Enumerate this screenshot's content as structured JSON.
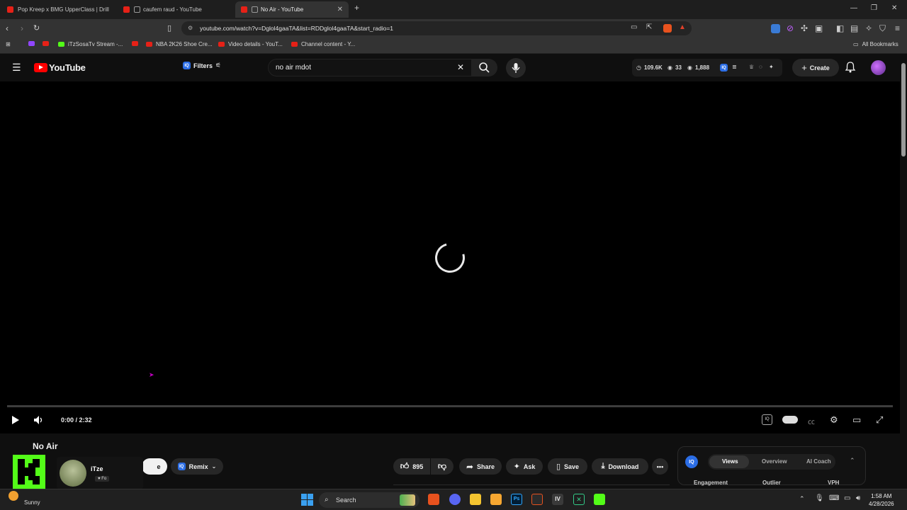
{
  "browser": {
    "tabs": [
      {
        "label": "Pop Kreep x BMG UpperClass | Drill"
      },
      {
        "label": "caufem raud - YouTube"
      },
      {
        "label": "No Air - YouTube",
        "active": true
      }
    ],
    "url": "youtube.com/watch?v=Dglol4gaaTA&list=RDDglol4gaaTA&start_radio=1",
    "bookmarks": [
      {
        "label": "iTzSosaTv Stream -..."
      },
      {
        "label": "NBA 2K26 Shoe Cre..."
      },
      {
        "label": "Video details - YouT..."
      },
      {
        "label": "Channel content - Y..."
      }
    ],
    "all_bookmarks": "All Bookmarks"
  },
  "youtube": {
    "logo_text": "YouTube",
    "filters_label": "Filters",
    "search_value": "no air mdot",
    "stats": {
      "views": "109.6K",
      "count_a": "33",
      "count_b": "1,888"
    },
    "create_label": "Create"
  },
  "player": {
    "time": "0:00 / 2:32",
    "progress": 0
  },
  "video": {
    "title": "No Air",
    "remix_label": "Remix",
    "likes": "895",
    "share_label": "Share",
    "ask_label": "Ask",
    "save_label": "Save",
    "download_label": "Download"
  },
  "iq_panel": {
    "badge": "IQ",
    "tabs": [
      "Views",
      "Overview",
      "AI Coach"
    ],
    "active_tab": "Views",
    "columns": [
      "Engagement",
      "Outlier",
      "VPH"
    ]
  },
  "overlay": {
    "name": "iTze",
    "sub": "Fo"
  },
  "taskbar": {
    "weather": "Sunny",
    "search_label": "Search",
    "time": "1:58 AM",
    "date": "4/28/2026"
  },
  "colors": {
    "youtube_red": "#ff0000",
    "kick_green": "#53fc18",
    "iq_blue": "#2b6de5"
  }
}
